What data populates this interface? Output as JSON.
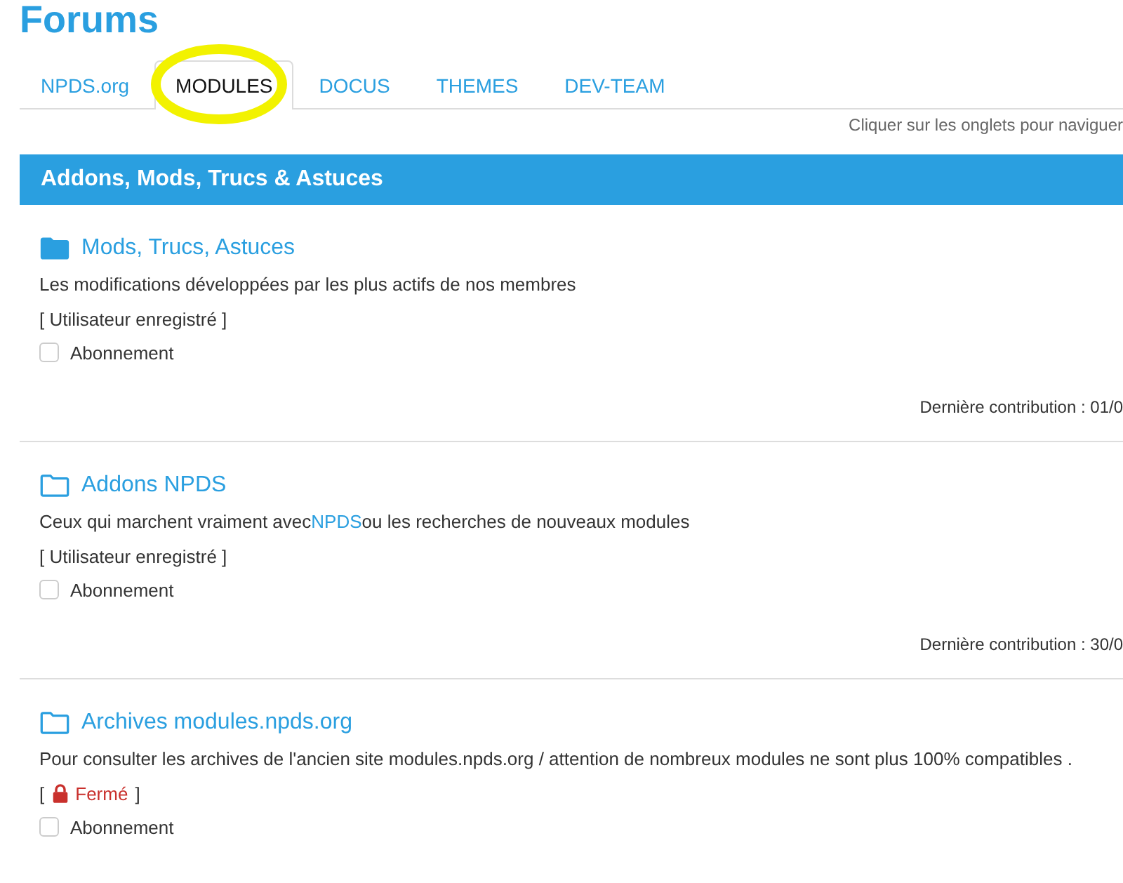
{
  "title": "Forums",
  "tabs": [
    {
      "label": "NPDS.org",
      "selected": false,
      "highlighted": false
    },
    {
      "label": "MODULES",
      "selected": true,
      "highlighted": true
    },
    {
      "label": "DOCUS",
      "selected": false,
      "highlighted": false
    },
    {
      "label": "THEMES",
      "selected": false,
      "highlighted": false
    },
    {
      "label": "DEV-TEAM",
      "selected": false,
      "highlighted": false
    }
  ],
  "hint": "Cliquer sur les onglets pour naviguer",
  "category": "Addons, Mods, Trucs & Astuces",
  "forums": [
    {
      "title": "Mods, Trucs, Astuces",
      "unread": true,
      "description": [
        {
          "kind": "text",
          "text": "Les modifications développées par les plus actifs de nos membres"
        }
      ],
      "access": {
        "kind": "registered",
        "label": "[ Utilisateur enregistré ]"
      },
      "subscribe": {
        "label": "Abonnement",
        "checked": false
      },
      "last_post": "Dernière contribution : 01/0"
    },
    {
      "title": "Addons NPDS",
      "unread": false,
      "description": [
        {
          "kind": "text",
          "text": "Ceux qui marchent vraiment avec"
        },
        {
          "kind": "link",
          "text": "NPDS"
        },
        {
          "kind": "text",
          "text": "ou les recherches de nouveaux modules"
        }
      ],
      "access": {
        "kind": "registered",
        "label": "[ Utilisateur enregistré ]"
      },
      "subscribe": {
        "label": "Abonnement",
        "checked": false
      },
      "last_post": "Dernière contribution : 30/0"
    },
    {
      "title": "Archives modules.npds.org",
      "unread": false,
      "description": [
        {
          "kind": "text",
          "text": "Pour consulter les archives de l'ancien site modules.npds.org / attention de nombreux modules ne sont plus 100% compatibles ."
        }
      ],
      "access": {
        "kind": "closed",
        "label": "Fermé",
        "open_bracket": "[",
        "close_bracket": "]"
      },
      "subscribe": {
        "label": "Abonnement",
        "checked": false
      }
    }
  ]
}
